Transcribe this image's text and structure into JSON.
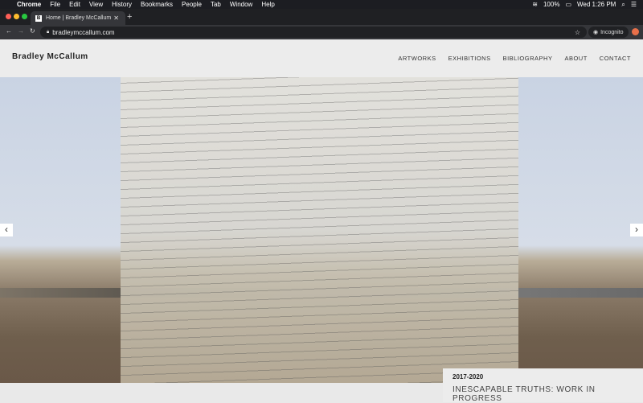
{
  "menubar": {
    "app": "Chrome",
    "items": [
      "File",
      "Edit",
      "View",
      "History",
      "Bookmarks",
      "People",
      "Tab",
      "Window",
      "Help"
    ],
    "battery": "100%",
    "clock": "Wed 1:26 PM"
  },
  "browser": {
    "tab_title": "Home | Bradley McCallum",
    "favicon": "B",
    "url": "bradleymccallum.com",
    "profile": "Incognito"
  },
  "site": {
    "brand": "Bradley McCallum",
    "nav": [
      "ARTWORKS",
      "EXHIBITIONS",
      "BIBLIOGRAPHY",
      "ABOUT",
      "CONTACT"
    ]
  },
  "slide": {
    "years": "2017-2020",
    "title": "INESCAPABLE TRUTHS: WORK IN PROGRESS"
  }
}
